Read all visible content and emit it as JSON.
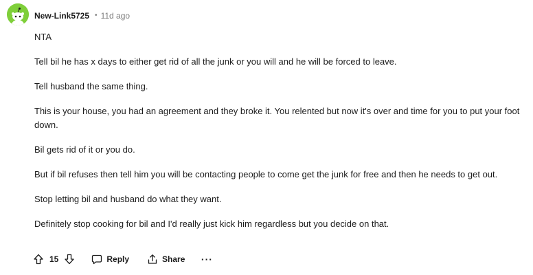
{
  "comment": {
    "author": "New-Link5725",
    "separator": "•",
    "timestamp": "11d ago",
    "paragraphs": [
      "NTA",
      "Tell bil he has x days to either get rid of all the junk or you will and he will be forced to leave.",
      "Tell husband the same thing.",
      "This is your house, you had an agreement and they broke it. You relented but now it's over and time for you to put your foot down.",
      "Bil gets rid of it or you do.",
      "But if bil refuses then tell him you will be contacting people to come get the junk for free and then he needs to get out.",
      "Stop letting bil and husband do what they want.",
      "Definitely stop cooking for bil and I'd really just kick him regardless but you decide on that."
    ]
  },
  "actions": {
    "score": "15",
    "reply_label": "Reply",
    "share_label": "Share",
    "more_label": "···"
  },
  "icons": {
    "avatar": "snoo-avatar-icon",
    "upvote": "upvote-arrow-icon",
    "downvote": "downvote-arrow-icon",
    "reply": "speech-bubble-icon",
    "share": "share-icon",
    "more": "ellipsis-icon"
  },
  "colors": {
    "avatar_bg": "#7fcf3a",
    "text": "#1c1c1c",
    "meta": "#7c7c7c"
  }
}
